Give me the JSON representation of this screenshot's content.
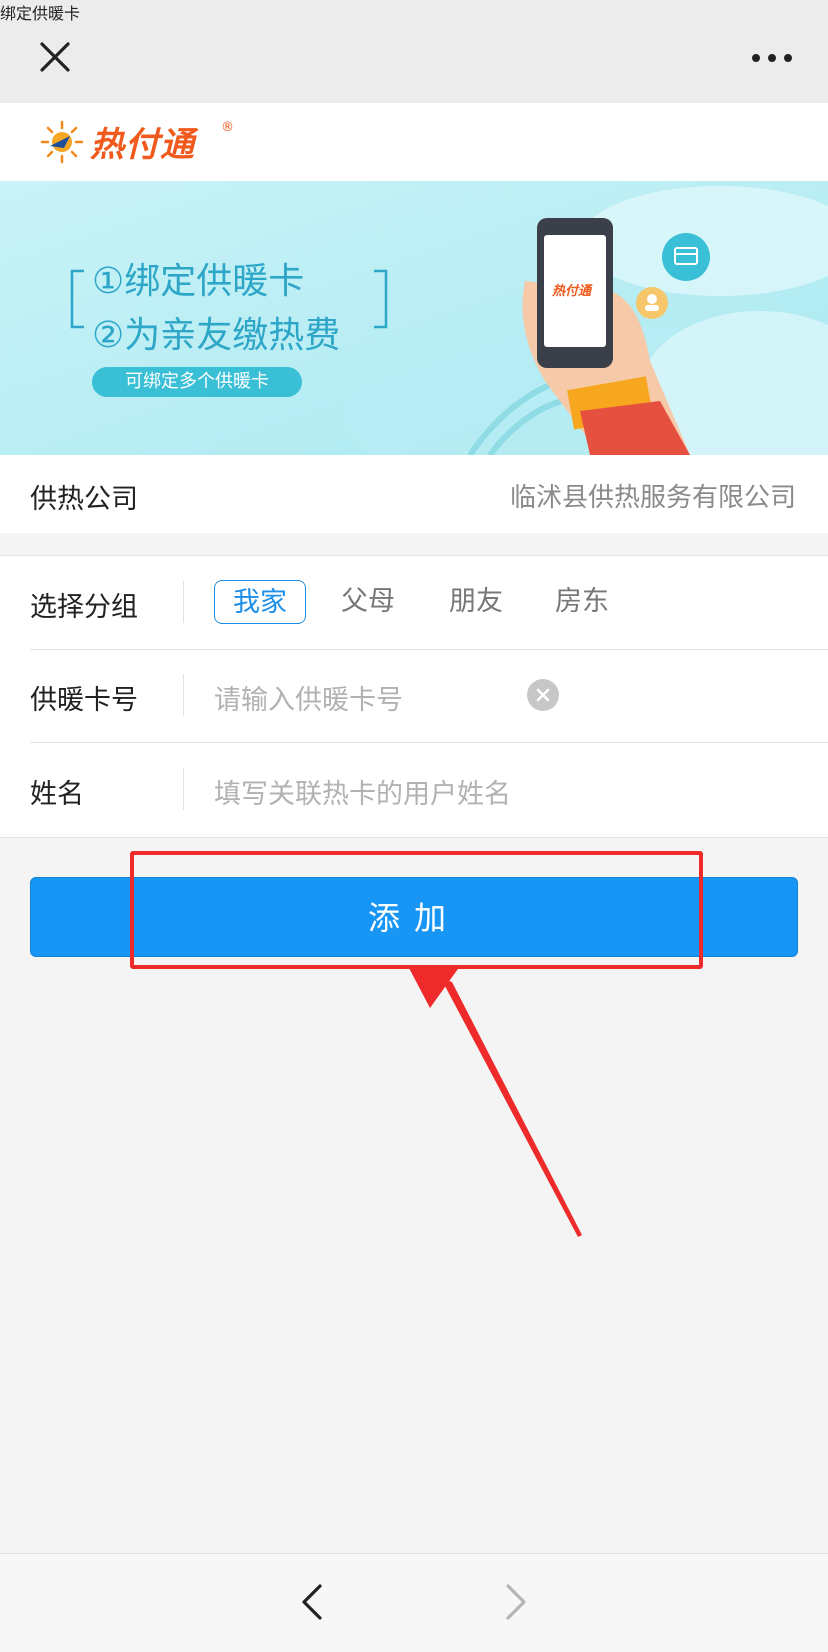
{
  "topbar": {
    "title": "绑定供暖卡",
    "close_icon": "close-icon",
    "more_icon": "more-dots-icon"
  },
  "logo": {
    "text": "热付通",
    "reg": "®"
  },
  "banner": {
    "line1": "①绑定供暖卡",
    "line2": "②为亲友缴热费",
    "pill": "可绑定多个供暖卡",
    "phone_logo": "热付通",
    "colors": {
      "bg": "#c3f0f6",
      "accent": "#2ea6c8"
    }
  },
  "company": {
    "label": "供热公司",
    "value": "临沭县供热服务有限公司"
  },
  "group": {
    "label": "选择分组",
    "options": [
      "我家",
      "父母",
      "朋友",
      "房东"
    ],
    "selected": "我家"
  },
  "card": {
    "label": "供暖卡号",
    "placeholder": "请输入供暖卡号"
  },
  "name": {
    "label": "姓名",
    "placeholder": "填写关联热卡的用户姓名"
  },
  "add_button": {
    "label": "添加",
    "color": "#1896f5"
  },
  "annotation": {
    "color": "#ee2a2a"
  },
  "nav": {
    "back_icon": "chevron-left-icon",
    "forward_icon": "chevron-right-icon"
  }
}
